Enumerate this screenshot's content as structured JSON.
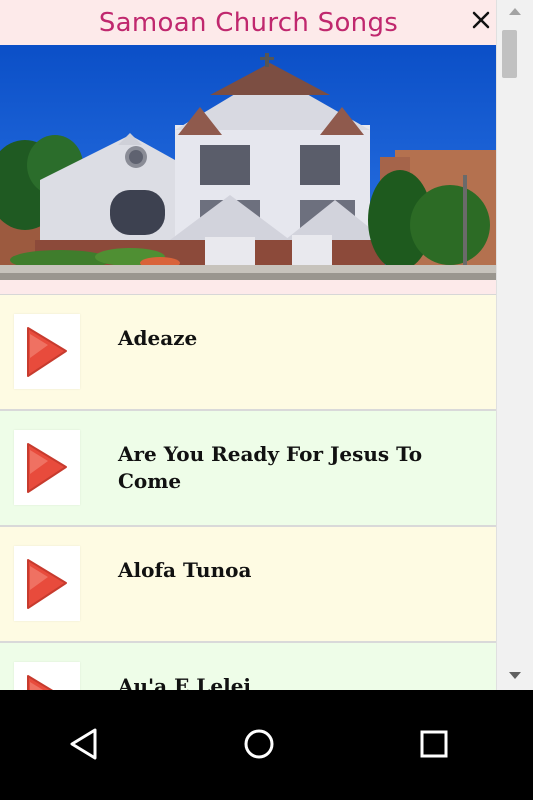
{
  "header": {
    "title": "Samoan Church Songs"
  },
  "icons": {
    "close": "close-icon",
    "play": "play-icon",
    "back": "back-icon",
    "home": "home-icon",
    "recents": "recents-icon"
  },
  "colors": {
    "title": "#c0286e",
    "header_bg": "#fdeaea",
    "row_odd": "#fefbe3",
    "row_even": "#eefde8",
    "play_red": "#e84b3c"
  },
  "songs": [
    {
      "title": "Adeaze"
    },
    {
      "title": "Are You Ready For Jesus To Come"
    },
    {
      "title": "Alofa Tunoa"
    },
    {
      "title": "Au'a E Lelei"
    }
  ]
}
